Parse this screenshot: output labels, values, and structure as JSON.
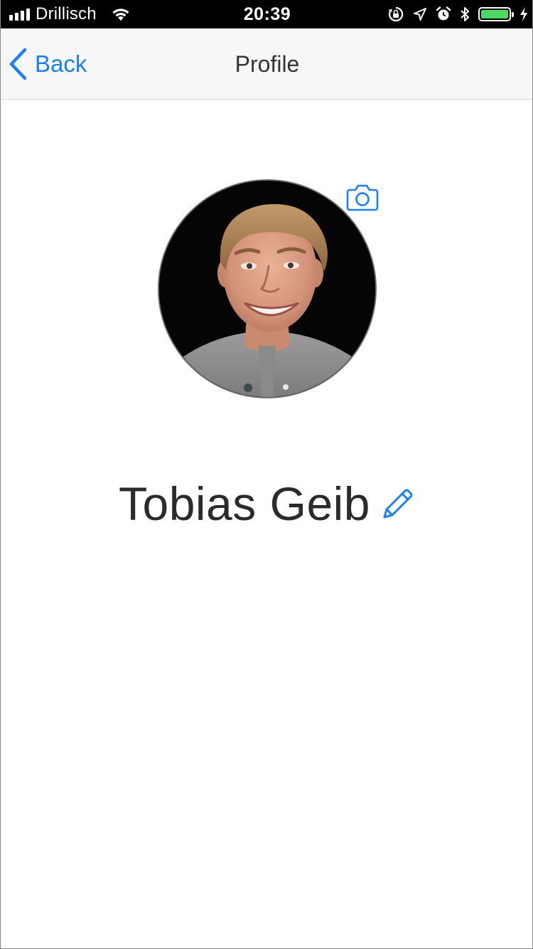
{
  "status_bar": {
    "carrier": "Drillisch",
    "time": "20:39",
    "battery_level": 1.0,
    "icons": [
      "signal-icon",
      "wifi-icon",
      "orientation-lock-icon",
      "location-icon",
      "alarm-icon",
      "bluetooth-icon",
      "battery-icon",
      "charging-icon"
    ]
  },
  "nav": {
    "back_label": "Back",
    "title": "Profile"
  },
  "profile": {
    "name": "Tobias Geib",
    "avatar_icon": "profile-photo",
    "camera_icon": "camera-icon",
    "edit_icon": "pencil-icon"
  },
  "colors": {
    "accent": "#1a7ff2",
    "nav_background": "#f7f7f7",
    "text": "#2b2b2b",
    "battery": "#4cd964"
  }
}
